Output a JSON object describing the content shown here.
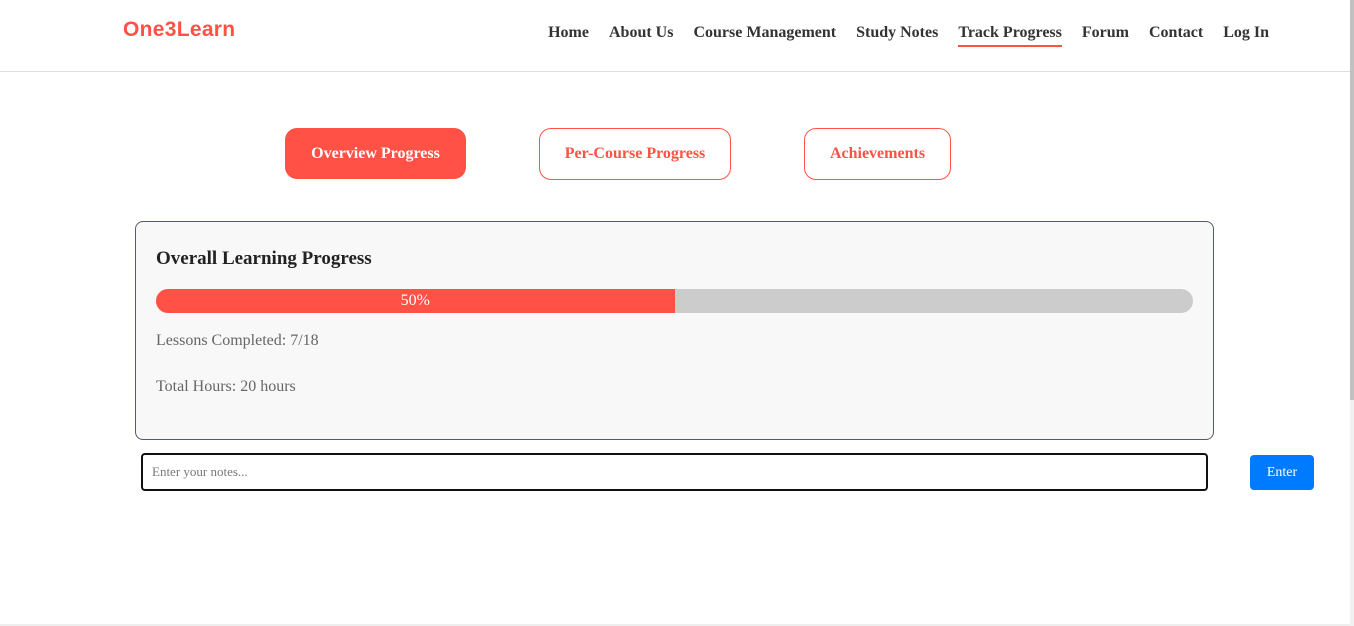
{
  "header": {
    "logo": "One3Learn",
    "nav": [
      {
        "label": "Home"
      },
      {
        "label": "About Us"
      },
      {
        "label": "Course Management"
      },
      {
        "label": "Study Notes"
      },
      {
        "label": "Track Progress",
        "active": true
      },
      {
        "label": "Forum"
      },
      {
        "label": "Contact"
      },
      {
        "label": "Log In"
      }
    ]
  },
  "tabs": [
    {
      "label": "Overview Progress",
      "active": true
    },
    {
      "label": "Per-Course Progress"
    },
    {
      "label": "Achievements"
    }
  ],
  "overview": {
    "title": "Overall Learning Progress",
    "progress_percent": 50,
    "progress_label": "50%",
    "lessons_completed": "Lessons Completed: 7/18",
    "total_hours": "Total Hours: 20 hours"
  },
  "notes": {
    "placeholder": "Enter your notes...",
    "value": "",
    "button_label": "Enter"
  },
  "colors": {
    "accent": "#ff5145",
    "button_blue": "#007bff",
    "track_gray": "#cccccc"
  }
}
